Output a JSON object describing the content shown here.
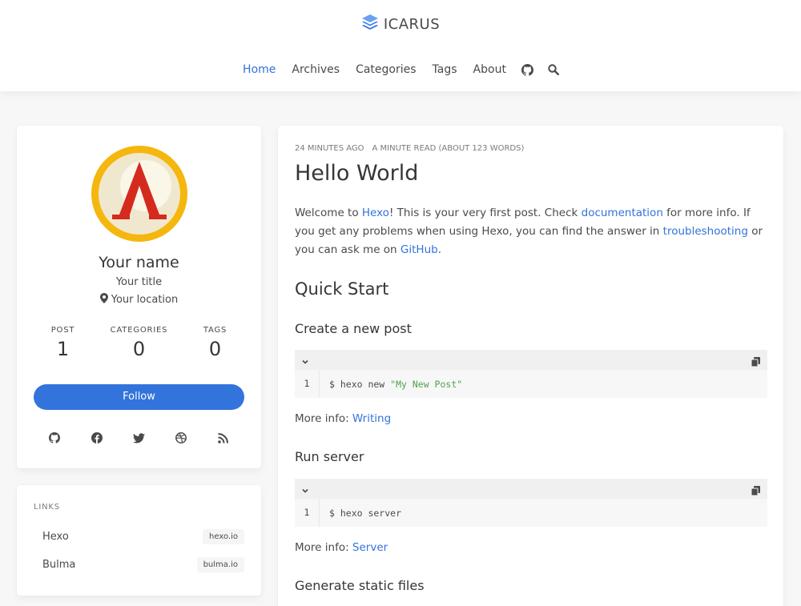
{
  "brand": {
    "name": "ICARUS",
    "logo": "stacked-layers-icon",
    "color": "#3273dc"
  },
  "nav": {
    "items": [
      "Home",
      "Archives",
      "Categories",
      "Tags",
      "About"
    ],
    "active": "Home",
    "icons": [
      "github-icon",
      "search-icon"
    ]
  },
  "profile": {
    "name": "Your name",
    "title": "Your title",
    "location": "Your location",
    "stats": [
      {
        "label": "POST",
        "value": "1"
      },
      {
        "label": "CATEGORIES",
        "value": "0"
      },
      {
        "label": "TAGS",
        "value": "0"
      }
    ],
    "follow_label": "Follow",
    "socials": [
      "github-icon",
      "facebook-icon",
      "twitter-icon",
      "dribbble-icon",
      "rss-icon"
    ]
  },
  "links": {
    "title": "LINKS",
    "items": [
      {
        "name": "Hexo",
        "url": "hexo.io"
      },
      {
        "name": "Bulma",
        "url": "bulma.io"
      }
    ]
  },
  "article": {
    "time": "24 MINUTES AGO",
    "read": "A MINUTE READ (ABOUT 123 WORDS)",
    "title": "Hello World",
    "intro": {
      "t1": "Welcome to ",
      "l1": "Hexo",
      "t2": "! This is your very first post. Check ",
      "l2": "documentation",
      "t3": " for more info. If you get any problems when using Hexo, you can find the answer in ",
      "l3": "troubleshooting",
      "t4": " or you can ask me on ",
      "l4": "GitHub",
      "t5": "."
    },
    "quick_start": "Quick Start",
    "sections": [
      {
        "heading": "Create a new post",
        "line": "1",
        "cmd": "$ hexo new ",
        "str": "\"My New Post\"",
        "more_label": "More info: ",
        "more_link": "Writing"
      },
      {
        "heading": "Run server",
        "line": "1",
        "cmd": "$ hexo server",
        "str": "",
        "more_label": "More info: ",
        "more_link": "Server"
      }
    ],
    "next_heading": "Generate static files"
  }
}
